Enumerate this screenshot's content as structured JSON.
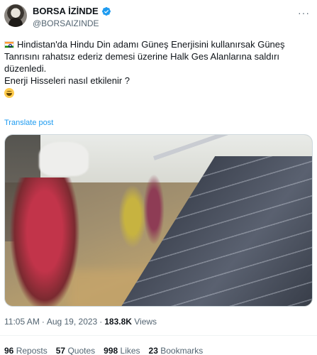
{
  "author": {
    "display_name": "BORSA İZİNDE",
    "handle": "@BORSAIZINDE",
    "verified_icon": "verified-badge-icon",
    "colors": {
      "verified": "#1d9bf0"
    }
  },
  "tweet": {
    "paragraph1": "Hindistan'da Hindu Din adamı Güneş Enerjisini kullanırsak Güneş Tanrısını rahatsız ederiz demesi üzerine Halk Ges Alanlarına saldırı düzenledi.",
    "paragraph2": "Enerji Hisseleri nasıl etkilenir ?",
    "flag_icon": "india-flag-icon",
    "emoji_icon": "grinning-face-emoji-icon",
    "translate_link": "Translate post"
  },
  "meta": {
    "time": "11:05 AM",
    "separator": "·",
    "date": "Aug 19, 2023",
    "views_count": "183.8K",
    "views_label": "Views"
  },
  "stats": {
    "reposts_count": "96",
    "reposts_label": "Reposts",
    "quotes_count": "57",
    "quotes_label": "Quotes",
    "likes_count": "998",
    "likes_label": "Likes",
    "bookmarks_count": "23",
    "bookmarks_label": "Bookmarks"
  },
  "colors": {
    "text_primary": "#0f1419",
    "text_secondary": "#536471",
    "link": "#1d9bf0"
  }
}
